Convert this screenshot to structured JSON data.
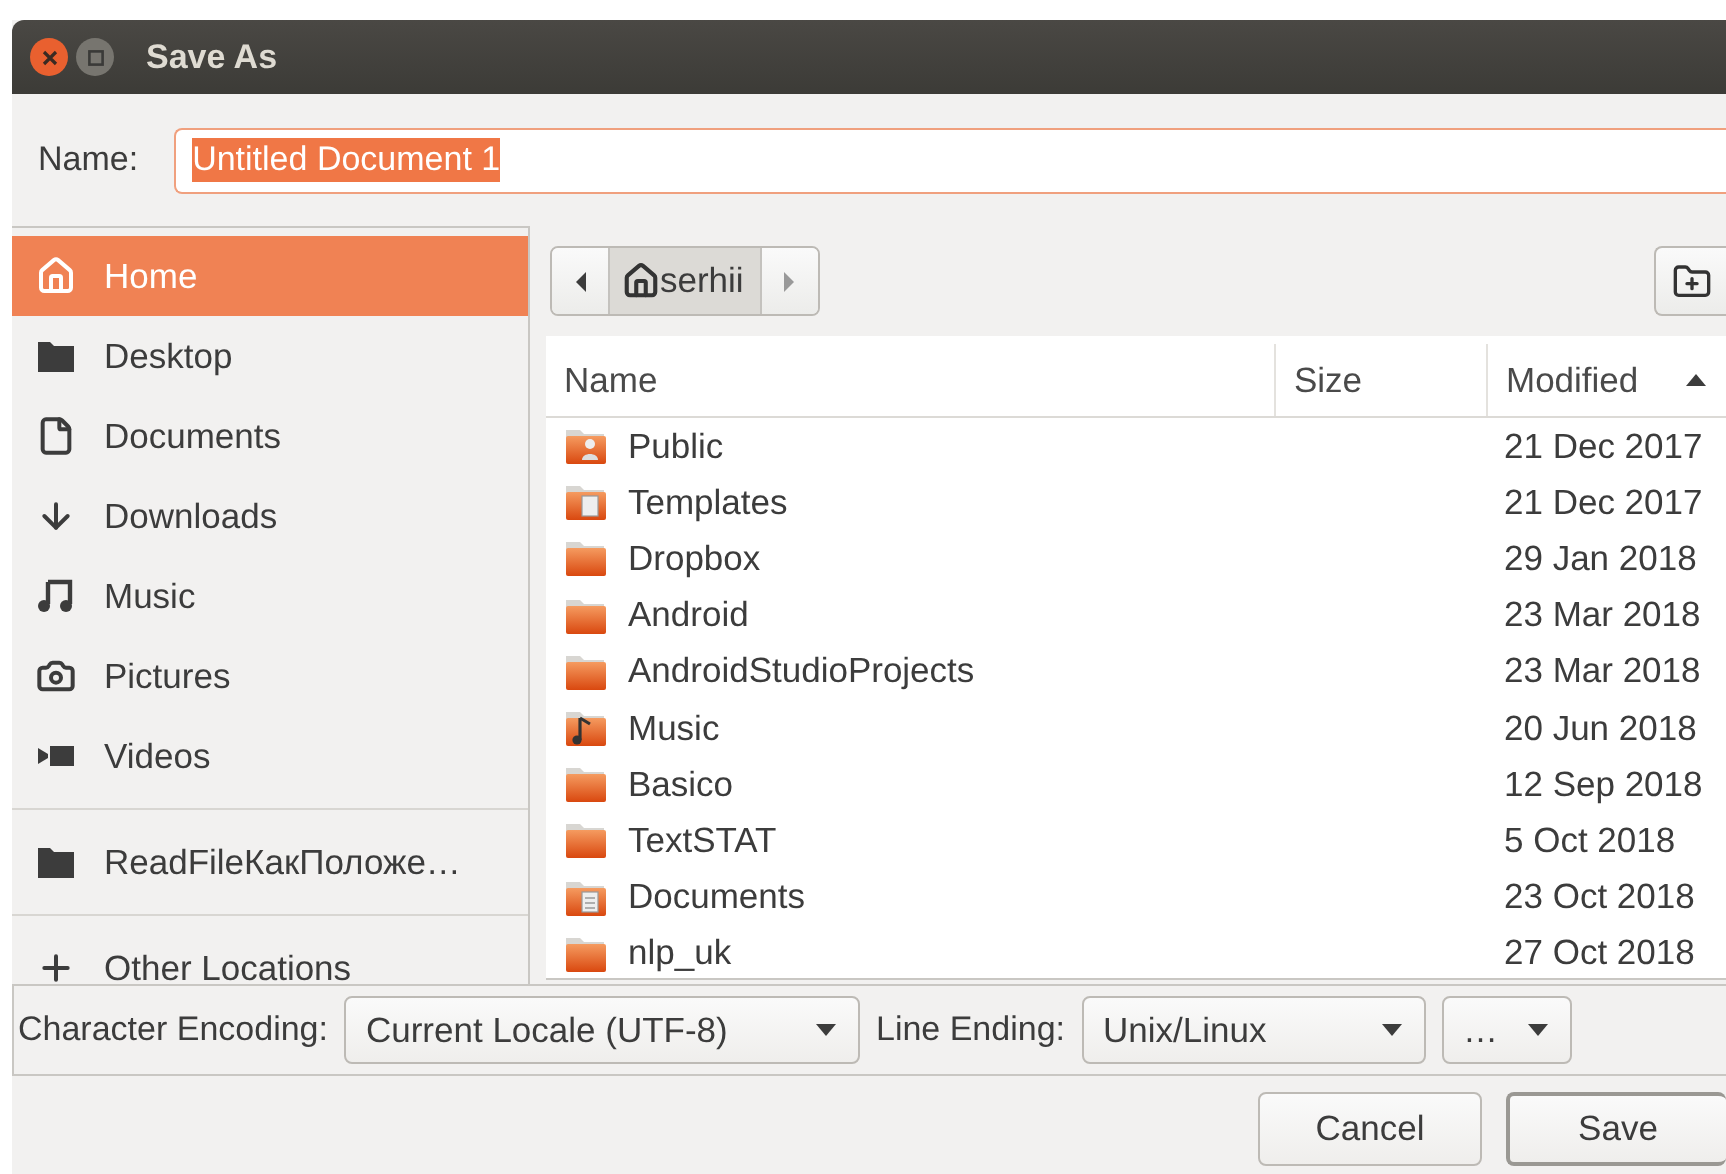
{
  "window": {
    "title": "Save As"
  },
  "name_field": {
    "label": "Name:",
    "value": "Untitled Document 1",
    "text_selected": true
  },
  "sidebar": {
    "sections": [
      [
        {
          "label": "Home",
          "kind": "home",
          "selected": true
        },
        {
          "label": "Desktop",
          "kind": "folder",
          "selected": false
        },
        {
          "label": "Documents",
          "kind": "document",
          "selected": false
        },
        {
          "label": "Downloads",
          "kind": "download",
          "selected": false
        },
        {
          "label": "Music",
          "kind": "music",
          "selected": false
        },
        {
          "label": "Pictures",
          "kind": "camera",
          "selected": false
        },
        {
          "label": "Videos",
          "kind": "video",
          "selected": false
        }
      ],
      [
        {
          "label": "ReadFileКакПоложе…",
          "kind": "folder",
          "selected": false
        }
      ],
      [
        {
          "label": "Other Locations",
          "kind": "plus",
          "selected": false
        }
      ]
    ]
  },
  "path_bar": {
    "segments": [
      {
        "label": "serhii",
        "selected": true
      }
    ]
  },
  "table": {
    "columns": [
      {
        "label": "Name",
        "sorted": false
      },
      {
        "label": "Size",
        "sorted": false
      },
      {
        "label": "Modified",
        "sorted": true
      }
    ],
    "rows": [
      {
        "name": "Public",
        "kind": "public",
        "modified": "21 Dec 2017"
      },
      {
        "name": "Templates",
        "kind": "templates",
        "modified": "21 Dec 2017"
      },
      {
        "name": "Dropbox",
        "kind": "folder",
        "modified": "29 Jan 2018"
      },
      {
        "name": "Android",
        "kind": "folder",
        "modified": "23 Mar 2018"
      },
      {
        "name": "AndroidStudioProjects",
        "kind": "folder",
        "modified": "23 Mar 2018"
      },
      {
        "name": "Music",
        "kind": "music",
        "modified": "20 Jun 2018"
      },
      {
        "name": "Basico",
        "kind": "folder",
        "modified": "12 Sep 2018"
      },
      {
        "name": "TextSTAT",
        "kind": "folder",
        "modified": "5 Oct 2018"
      },
      {
        "name": "Documents",
        "kind": "documents",
        "modified": "23 Oct 2018"
      },
      {
        "name": "nlp_uk",
        "kind": "folder",
        "modified": "27 Oct 2018"
      }
    ]
  },
  "options": [
    {
      "label": "Character Encoding:",
      "value": "Current Locale (UTF-8)"
    },
    {
      "label": "Line Ending:",
      "value": "Unix/Linux"
    },
    {
      "value": "…"
    }
  ],
  "buttons": [
    {
      "label": "Cancel",
      "default": false
    },
    {
      "label": "Save",
      "default": true
    }
  ]
}
